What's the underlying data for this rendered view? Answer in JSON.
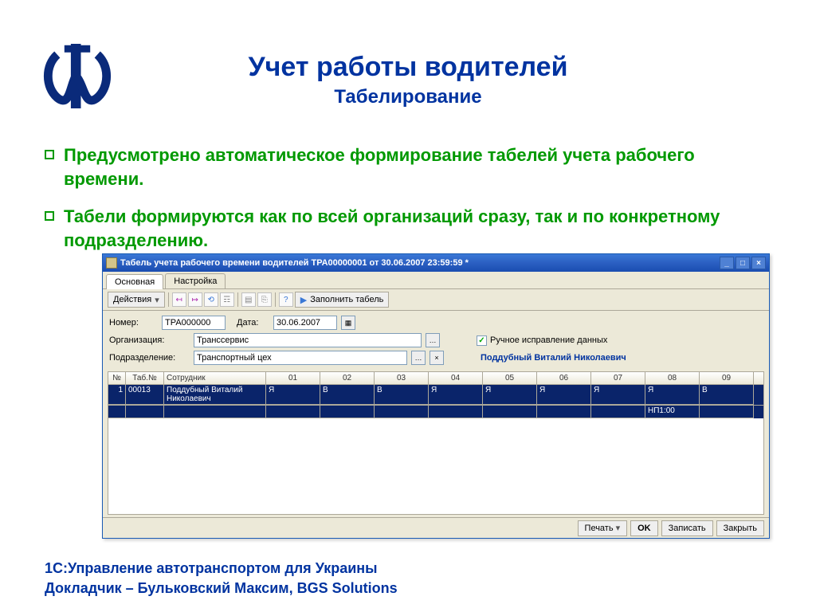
{
  "slide": {
    "title": "Учет работы водителей",
    "subtitle": "Табелирование",
    "bullets": [
      "Предусмотрено автоматическое формирование табелей учета рабочего времени.",
      "Табели формируются как по всей организаций сразу, так и по конкретному подразделению."
    ],
    "footer_line1": "1С:Управление автотранспортом для Украины",
    "footer_line2": "Докладчик – Бульковский Максим, BGS Solutions"
  },
  "app": {
    "window_title": "Табель учета рабочего времени водителей ТРА00000001 от 30.06.2007 23:59:59 *",
    "tabs": {
      "main": "Основная",
      "settings": "Настройка"
    },
    "toolbar": {
      "actions": "Действия",
      "fill": "Заполнить табель"
    },
    "fields": {
      "number_label": "Номер:",
      "number_value": "ТРА000000",
      "date_label": "Дата:",
      "date_value": "30.06.2007",
      "org_label": "Организация:",
      "org_value": "Транссервис",
      "dept_label": "Подразделение:",
      "dept_value": "Транспортный цех",
      "manual_label": "Ручное исправление данных",
      "employee_highlight": "Поддубный Виталий Николаевич"
    },
    "table": {
      "headers_fixed": [
        "№",
        "Таб.№",
        "Сотрудник"
      ],
      "headers_days": [
        "01",
        "02",
        "03",
        "04",
        "05",
        "06",
        "07",
        "08",
        "09"
      ],
      "row": {
        "n": "1",
        "tabn": "00013",
        "emp": "Поддубный Виталий Николаевич",
        "days": [
          "Я",
          "В",
          "В",
          "Я",
          "Я",
          "Я",
          "Я",
          "Я",
          "В"
        ],
        "extra": "НП1:00"
      }
    },
    "footer_buttons": {
      "print": "Печать",
      "ok": "OK",
      "save": "Записать",
      "close": "Закрыть"
    }
  }
}
